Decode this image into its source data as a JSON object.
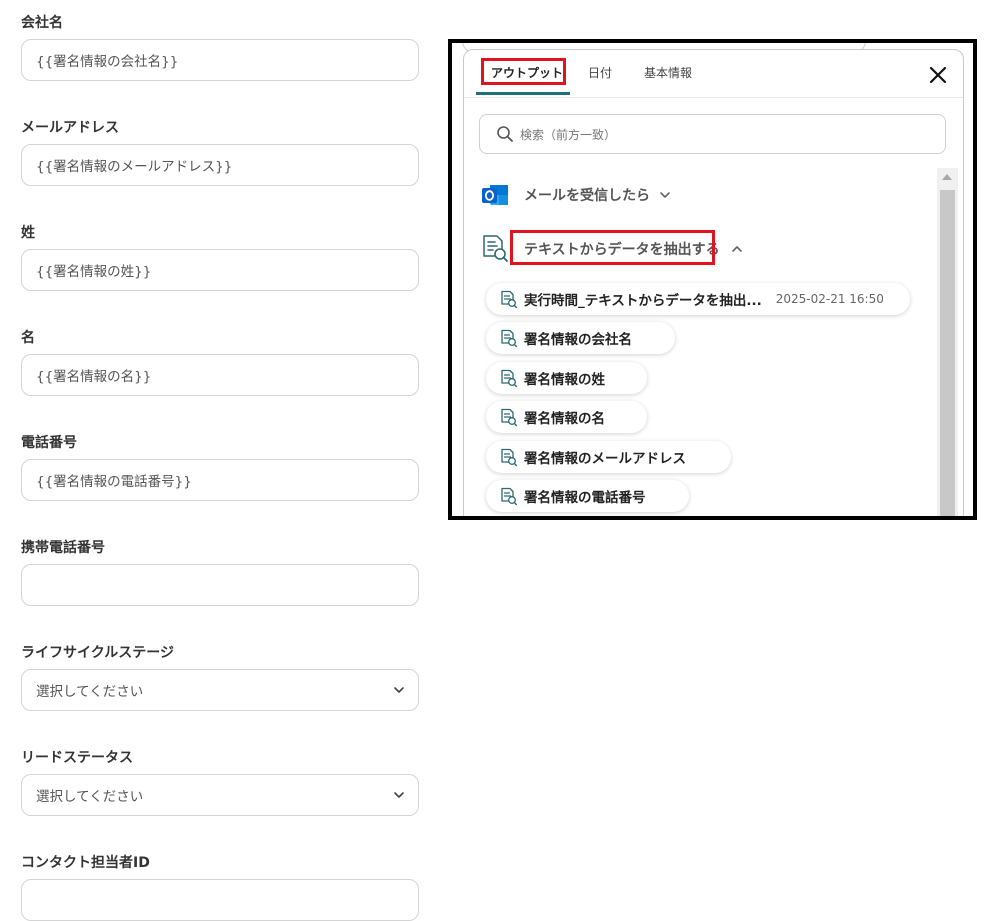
{
  "form": {
    "fields": [
      {
        "label": "会社名",
        "value": "{{署名情報の会社名}}"
      },
      {
        "label": "メールアドレス",
        "value": "{{署名情報のメールアドレス}}"
      },
      {
        "label": "姓",
        "value": "{{署名情報の姓}}"
      },
      {
        "label": "名",
        "value": "{{署名情報の名}}"
      },
      {
        "label": "電話番号",
        "value": "{{署名情報の電話番号}}"
      },
      {
        "label": "携帯電話番号",
        "value": ""
      },
      {
        "label": "ライフサイクルステージ",
        "value": "選択してください"
      },
      {
        "label": "リードステータス",
        "value": "選択してください"
      },
      {
        "label": "コンタクト担当者ID",
        "value": ""
      }
    ]
  },
  "panel": {
    "tabs": [
      "アウトプット",
      "日付",
      "基本情報"
    ],
    "active_tab": "アウトプット",
    "search_placeholder": "検索（前方一致）",
    "sections": [
      {
        "title": "メールを受信したら",
        "icon": "outlook-icon",
        "expanded": false
      },
      {
        "title": "テキストからデータを抽出する",
        "icon": "document-search-icon",
        "expanded": true
      }
    ],
    "items": [
      {
        "label": "実行時間_テキストからデータを抽出...",
        "meta": "2025-02-21 16:50"
      },
      {
        "label": "署名情報の会社名",
        "meta": ""
      },
      {
        "label": "署名情報の姓",
        "meta": ""
      },
      {
        "label": "署名情報の名",
        "meta": ""
      },
      {
        "label": "署名情報のメールアドレス",
        "meta": ""
      },
      {
        "label": "署名情報の電話番号",
        "meta": ""
      }
    ]
  },
  "colors": {
    "highlight": "#e0141e",
    "tab_underline": "#1d6f7a",
    "outlook_blue": "#0a64c8"
  }
}
